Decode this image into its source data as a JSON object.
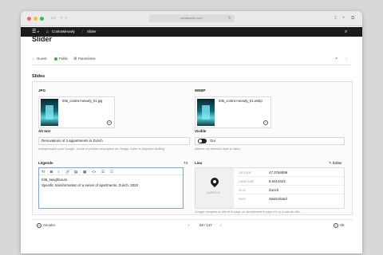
{
  "browser": {
    "url": "contenerie.com"
  },
  "appbar": {
    "site_name": "ContraMeuwly",
    "breadcrumb_page": "Slider"
  },
  "page": {
    "title": "Slider",
    "meta": {
      "status_label": "Ouvert",
      "visibility_label": "Public",
      "settings_label": "Paramètres"
    },
    "section_title": "Slides"
  },
  "slide": {
    "jpg": {
      "label": "JPG",
      "file_name": "036_contra-meuwly_01.jpg"
    },
    "webp": {
      "label": "WEBP",
      "file_name": "036_contra-meuwly_01.webp"
    },
    "alt_text": {
      "label": "Alt text",
      "value": "Renovations of 3 appartments in Zurich",
      "help": "Indispensable pour Google, courte et précise description de l'image, éviter le 'keyword stuffing'"
    },
    "visible": {
      "label": "Visible",
      "toggle_label": "Oui",
      "on": true,
      "help": "Afficher cet élément dans le slider"
    },
    "legend": {
      "label": "Légende",
      "char_count": "74",
      "toolbar": [
        "Tт",
        "B",
        "I",
        "🔗",
        "▤",
        "▦",
        "<>",
        "☰",
        "☷"
      ],
      "lines": [
        "036_Neighbours",
        "Specific transformation of a series of apartments, Zurich, 2020"
      ]
    },
    "location": {
      "label": "Lieu",
      "edit_label": "Éditer",
      "map_city": "ZURICH",
      "rows": [
        {
          "key": "LATITUDE",
          "value": "47.3764899"
        },
        {
          "key": "LONGITUDE",
          "value": "8.5410422"
        },
        {
          "key": "VILLE",
          "value": "Zurich"
        },
        {
          "key": "PAYS",
          "value": "Switzerland"
        }
      ],
      "help": "Google récupère la ville et le pays, ou simplement le pays s'il n'y a pas de ville."
    }
  },
  "footer": {
    "cancel_label": "Annuler",
    "pager": "59 / 137",
    "ok_label": "Ok"
  },
  "colors": {
    "appbar": "#1c1c1c",
    "status_green": "#3cb043",
    "editor_focus": "#7aa0ff"
  }
}
